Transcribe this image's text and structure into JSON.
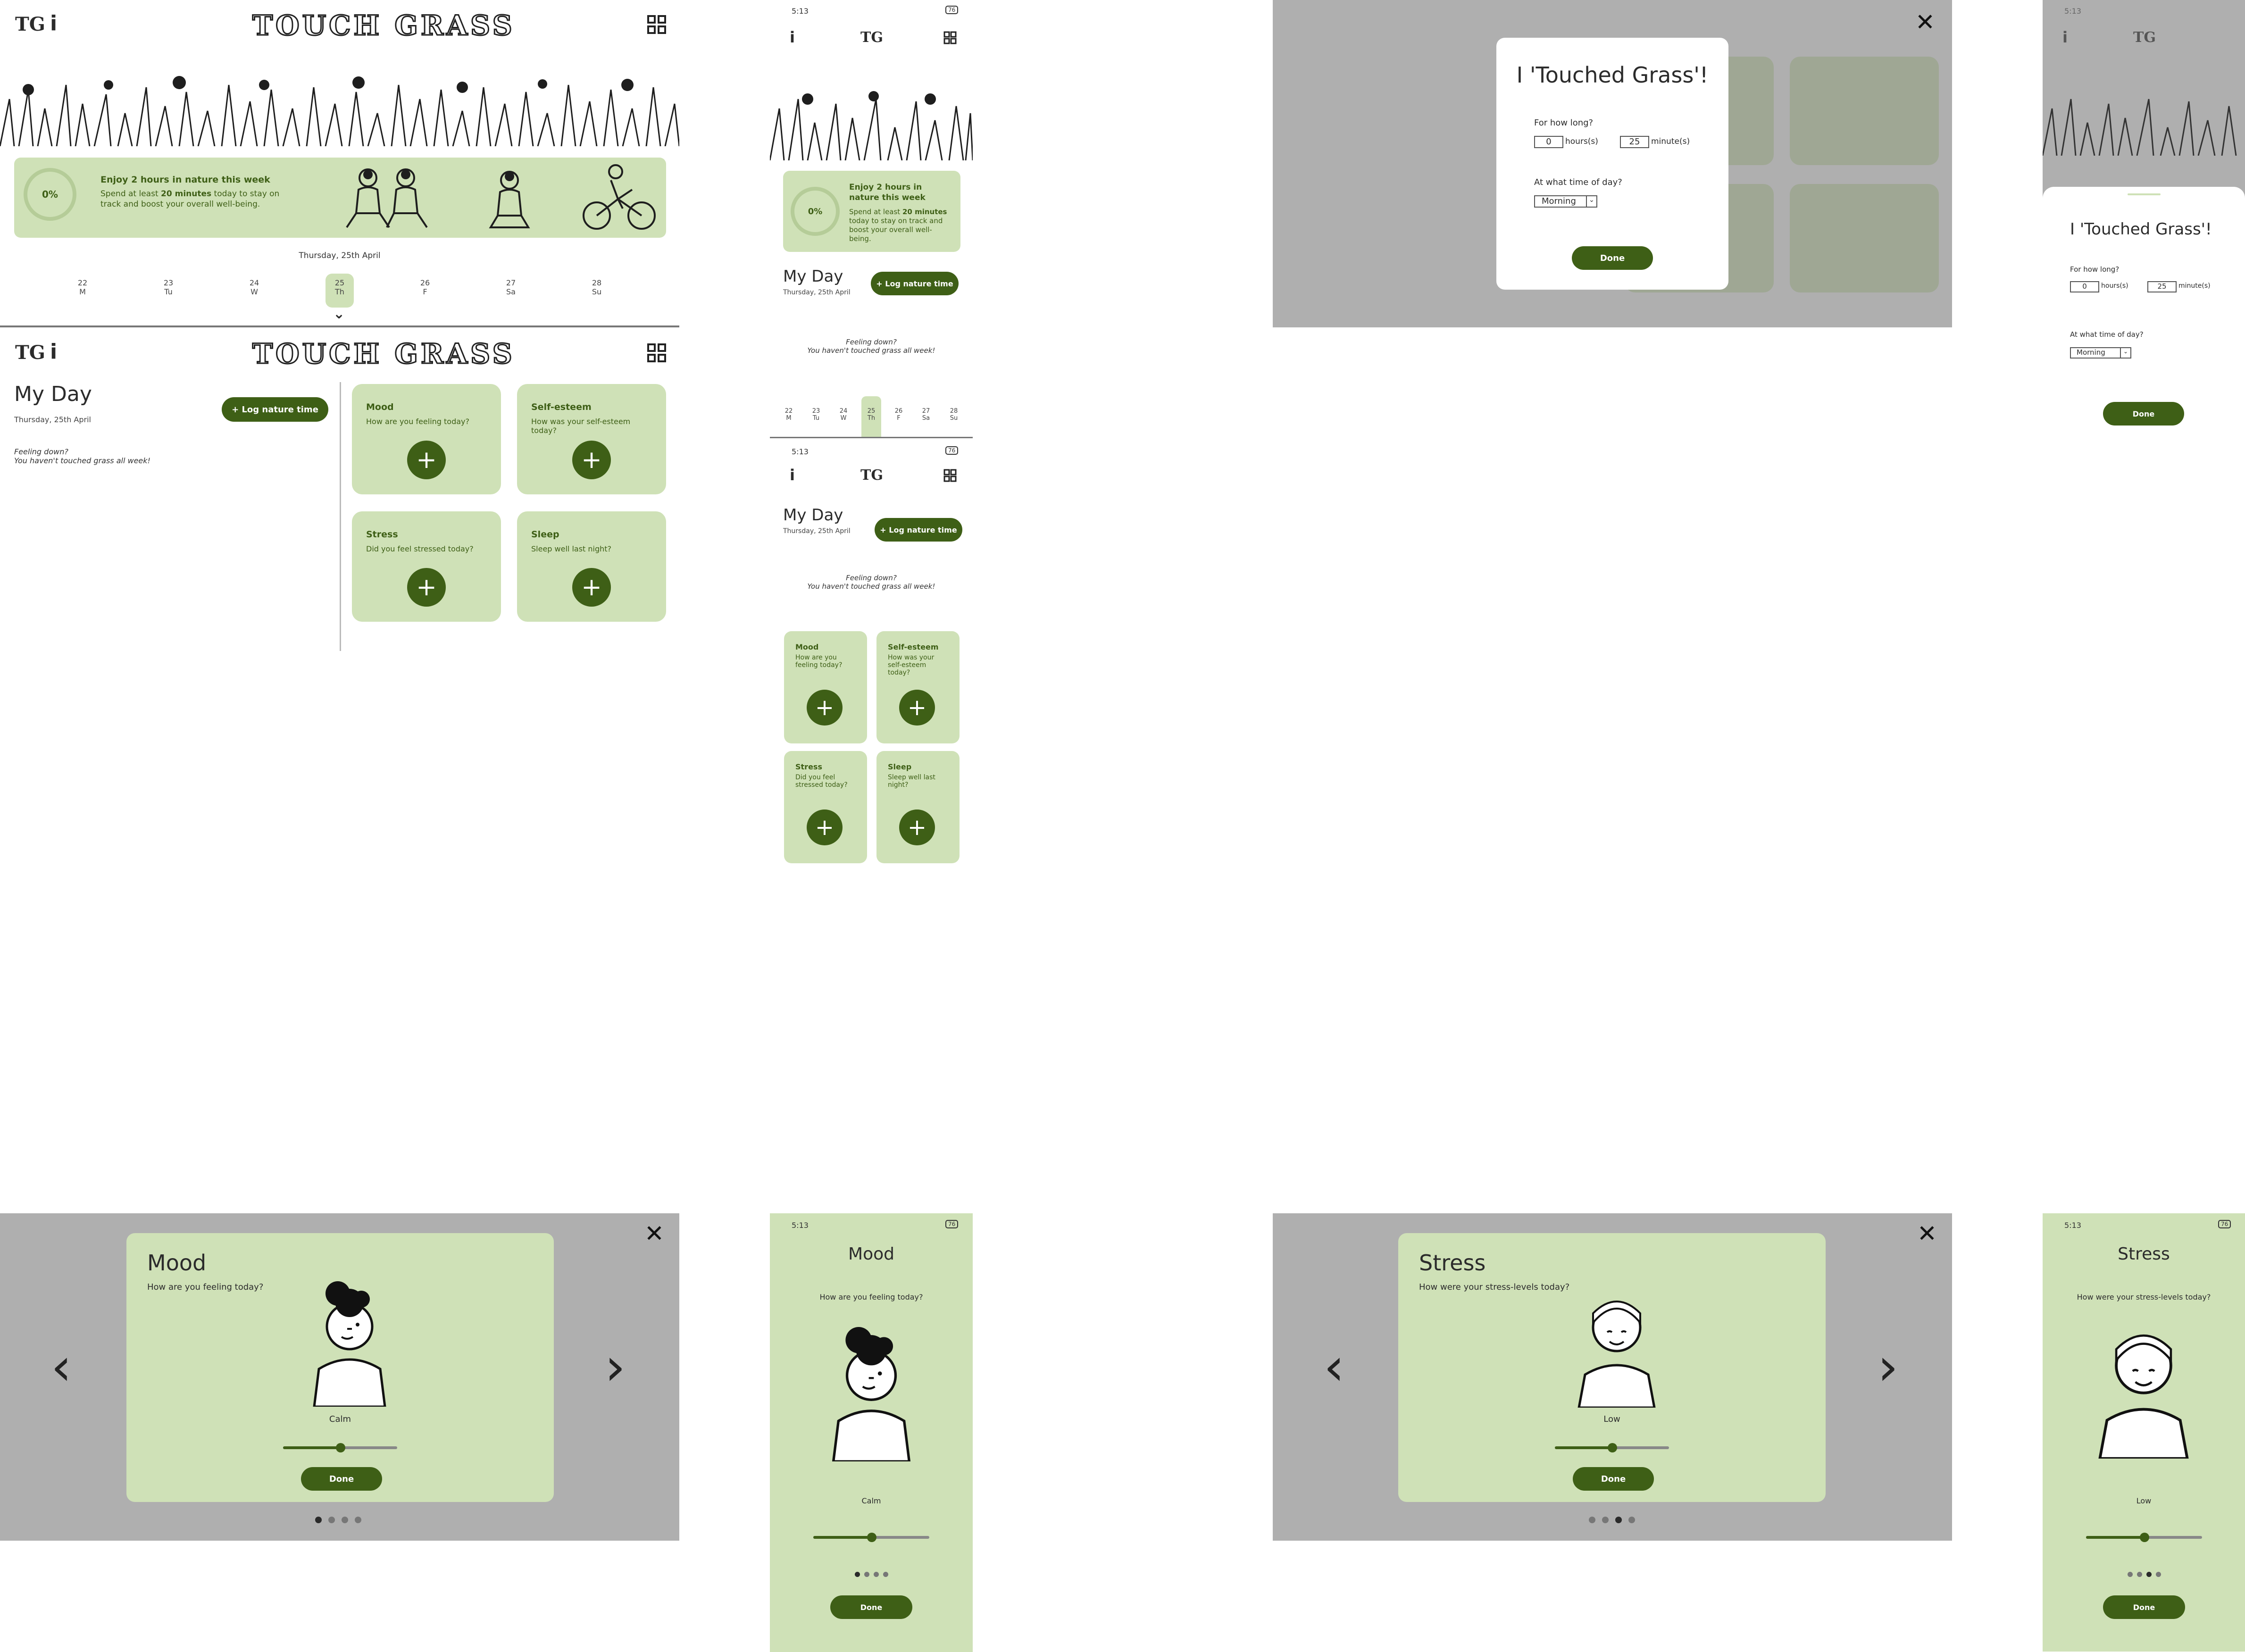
{
  "app": {
    "name": "TOUCH GRASS",
    "logo_text": "TG",
    "info_label": "i"
  },
  "banner": {
    "progress": "0%",
    "heading": "Enjoy 2 hours in nature this week",
    "body_pre": "Spend at least ",
    "body_bold": "20 minutes",
    "body_post": " today to stay on track and boost your overall well-being."
  },
  "calendar": {
    "date_label": "Thursday, 25th April",
    "days": [
      {
        "num": "22",
        "day": "M"
      },
      {
        "num": "23",
        "day": "Tu"
      },
      {
        "num": "24",
        "day": "W"
      },
      {
        "num": "25",
        "day": "Th"
      },
      {
        "num": "26",
        "day": "F"
      },
      {
        "num": "27",
        "day": "Sa"
      },
      {
        "num": "28",
        "day": "Su"
      }
    ],
    "selected_index": 3,
    "expand_glyph": "⌄"
  },
  "myday": {
    "title": "My Day",
    "date": "Thursday, 25th April",
    "log_button": "+ Log nature time",
    "feeling_line1": "Feeling down?",
    "feeling_line2": "You haven't touched grass all week!"
  },
  "cards": [
    {
      "title": "Mood",
      "desc": "How are you feeling today?"
    },
    {
      "title": "Self-esteem",
      "desc": "How was your self-esteem today?"
    },
    {
      "title": "Stress",
      "desc": "Did you feel stressed today?"
    },
    {
      "title": "Sleep",
      "desc": "Sleep well last night?"
    }
  ],
  "phone": {
    "time": "5:13",
    "battery": "76"
  },
  "log_modal": {
    "title": "I 'Touched Grass'!",
    "q_duration": "For how long?",
    "hours_value": "0",
    "hours_unit": "hours(s)",
    "minutes_value": "25",
    "minutes_unit": "minute(s)",
    "q_time": "At what time of day?",
    "time_value": "Morning",
    "done": "Done",
    "close": "✕"
  },
  "mood_modal": {
    "title": "Mood",
    "question": "How are you feeling today?",
    "value": "Calm",
    "level": 0.5,
    "done": "Done",
    "page": 1,
    "pages": 4,
    "prev": "‹",
    "next": "›"
  },
  "stress_modal": {
    "title": "Stress",
    "question": "How were your stress-levels today?",
    "value": "Low",
    "level": 0.5,
    "done": "Done",
    "page": 3,
    "pages": 4,
    "prev": "‹",
    "next": "›"
  },
  "colors": {
    "accent": "#3e5f16",
    "card": "#cfe1b7",
    "dim": "#9a9a9a"
  }
}
